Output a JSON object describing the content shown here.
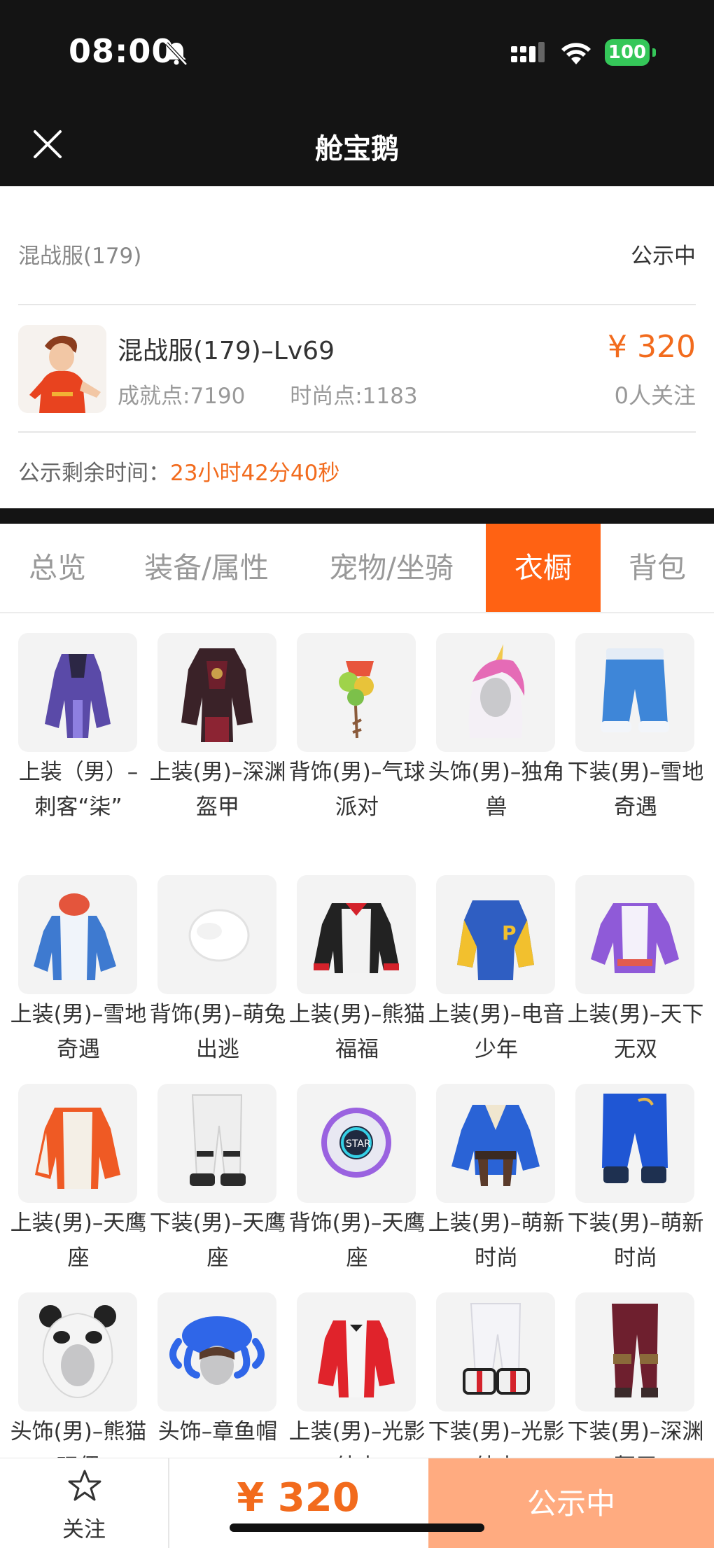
{
  "status_bar": {
    "time": "08:00",
    "battery": "100"
  },
  "nav": {
    "title": "舱宝鹅"
  },
  "listing": {
    "server": "混战服(179)",
    "status": "公示中",
    "role_title": "混战服(179)–Lv69",
    "achievement": "成就点:7190",
    "fashion": "时尚点:1183",
    "price": "¥ 320",
    "followers": "0人关注",
    "countdown_label": "公示剩余时间：",
    "countdown_value": "23小时42分40秒"
  },
  "tabs": [
    {
      "label": "总览",
      "active": false
    },
    {
      "label": "装备/属性",
      "active": false
    },
    {
      "label": "宠物/坐骑",
      "active": false
    },
    {
      "label": "衣橱",
      "active": true
    },
    {
      "label": "背包",
      "active": false
    }
  ],
  "wardrobe": [
    {
      "name": "上装（男）–刺客“柒”",
      "icon": "purple-robe-icon"
    },
    {
      "name": "上装(男)–深渊盔甲",
      "icon": "dark-armor-icon"
    },
    {
      "name": "背饰(男)–气球派对",
      "icon": "balloon-icon"
    },
    {
      "name": "头饰(男)–独角兽",
      "icon": "unicorn-hood-icon"
    },
    {
      "name": "下装(男)–雪地奇遇",
      "icon": "blue-shorts-icon"
    },
    {
      "name": "上装(男)–雪地奇遇",
      "icon": "blue-parka-icon"
    },
    {
      "name": "背饰(男)–萌兔出逃",
      "icon": "white-fluff-icon"
    },
    {
      "name": "上装(男)–熊猫福福",
      "icon": "panda-jacket-icon"
    },
    {
      "name": "上装(男)–电音少年",
      "icon": "varsity-jacket-icon"
    },
    {
      "name": "上装(男)–天下无双",
      "icon": "purple-outfit-icon"
    },
    {
      "name": "上装(男)–天鹰座",
      "icon": "orange-jacket-icon"
    },
    {
      "name": "下装(男)–天鹰座",
      "icon": "white-pants-icon"
    },
    {
      "name": "背饰(男)–天鹰座",
      "icon": "star-orb-icon"
    },
    {
      "name": "上装(男)–萌新时尚",
      "icon": "blue-kimono-icon"
    },
    {
      "name": "下装(男)–萌新时尚",
      "icon": "blue-pants-icon"
    },
    {
      "name": "头饰(男)–熊猫玩偶",
      "icon": "panda-hat-icon"
    },
    {
      "name": "头饰–章鱼帽",
      "icon": "octopus-hat-icon"
    },
    {
      "name": "上装(男)–光影绅士",
      "icon": "red-tux-icon"
    },
    {
      "name": "下装(男)–光影绅士",
      "icon": "white-boots-icon"
    },
    {
      "name": "下装(男)–深渊盔甲",
      "icon": "maroon-pants-icon"
    }
  ],
  "bottom_bar": {
    "follow_label": "关注",
    "price": "¥ 320",
    "status_label": "公示中"
  },
  "colors": {
    "accent": "#ff6213",
    "price": "#f26b1d",
    "dark": "#141414",
    "button_disabled": "#ffab80"
  }
}
